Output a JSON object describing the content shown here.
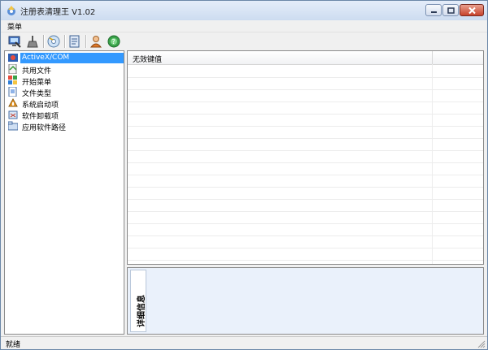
{
  "window": {
    "title": "注册表清理王 V1.02",
    "icon": "registry-cleaner-app-icon"
  },
  "window_controls": {
    "minimize": "minimize-icon",
    "maximize": "maximize-icon",
    "close": "close-icon"
  },
  "menubar": {
    "items": [
      {
        "label": "菜单"
      }
    ]
  },
  "toolbar": {
    "buttons": [
      {
        "icon": "scan-monitor-icon"
      },
      {
        "icon": "broom-clean-icon"
      },
      {
        "icon": "backup-disc-icon"
      },
      {
        "icon": "restore-document-icon"
      },
      {
        "icon": "user-icon"
      },
      {
        "icon": "globe-help-icon"
      }
    ]
  },
  "sidebar": {
    "items": [
      {
        "label": "ActiveX/COM",
        "icon": "activex-icon",
        "selected": true
      },
      {
        "label": "共用文件",
        "icon": "shared-file-icon"
      },
      {
        "label": "开始菜单",
        "icon": "start-menu-icon"
      },
      {
        "label": "文件类型",
        "icon": "file-type-icon"
      },
      {
        "label": "系统启动项",
        "icon": "startup-icon"
      },
      {
        "label": "软件卸载项",
        "icon": "uninstall-icon"
      },
      {
        "label": "应用软件路径",
        "icon": "app-path-icon"
      }
    ]
  },
  "list": {
    "columns": [
      {
        "label": "无效键值"
      },
      {
        "label": ""
      }
    ],
    "rows": []
  },
  "detail": {
    "tab_label": "详细信息"
  },
  "statusbar": {
    "text": "就绪"
  },
  "colors": {
    "selection": "#3399ff",
    "titlebar": "#cddcf0",
    "detail_bg": "#eaf1fb"
  }
}
